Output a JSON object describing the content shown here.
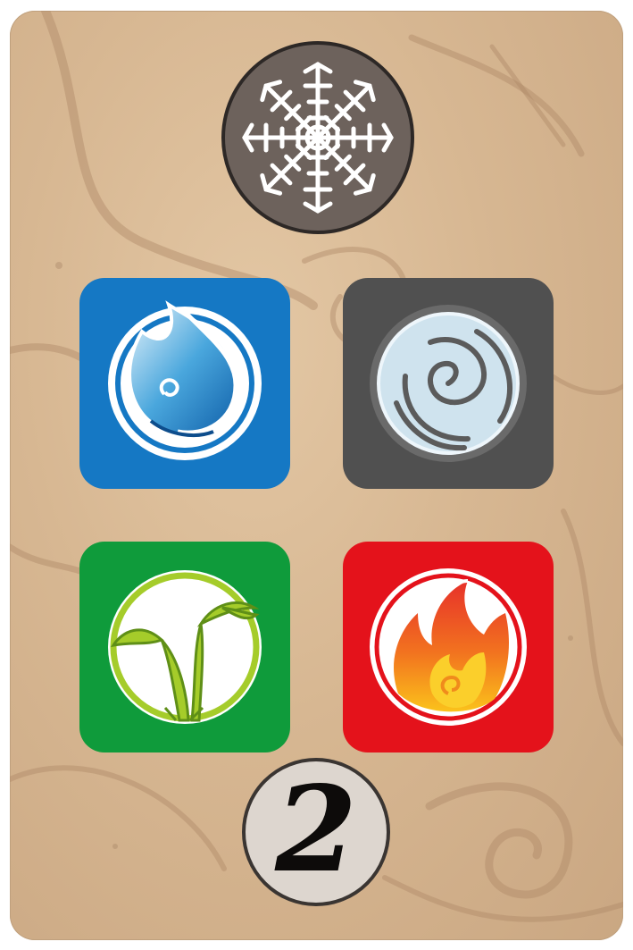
{
  "card": {
    "colors": {
      "parchment": "#d7b792",
      "rune_medallion": "#6d625c",
      "water_tile": "#1578c4",
      "air_tile": "#505050",
      "earth_tile": "#0f9b3b",
      "fire_tile": "#e4121b",
      "number_token": "#ddd6cf"
    },
    "top_symbol": "aegishjalmur-rune-icon",
    "elements": [
      {
        "name": "water",
        "icon": "water-drop-icon"
      },
      {
        "name": "air",
        "icon": "air-swirl-icon"
      },
      {
        "name": "earth",
        "icon": "earth-sprout-icon"
      },
      {
        "name": "fire",
        "icon": "fire-flame-icon"
      }
    ],
    "number": "2"
  }
}
